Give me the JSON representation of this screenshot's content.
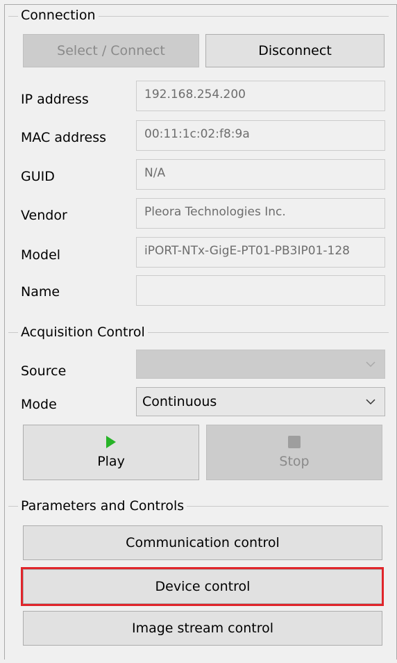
{
  "connection": {
    "title": "Connection",
    "select_connect_label": "Select / Connect",
    "disconnect_label": "Disconnect",
    "fields": [
      {
        "label": "IP address",
        "value": "192.168.254.200"
      },
      {
        "label": "MAC address",
        "value": "00:11:1c:02:f8:9a"
      },
      {
        "label": "GUID",
        "value": "N/A"
      },
      {
        "label": "Vendor",
        "value": "Pleora Technologies Inc."
      },
      {
        "label": "Model",
        "value": "iPORT-NTx-GigE-PT01-PB3IP01-128"
      },
      {
        "label": "Name",
        "value": ""
      }
    ]
  },
  "acquisition": {
    "title": "Acquisition Control",
    "source_label": "Source",
    "source_value": "",
    "mode_label": "Mode",
    "mode_value": "Continuous",
    "play_label": "Play",
    "stop_label": "Stop"
  },
  "parameters": {
    "title": "Parameters and Controls",
    "communication_label": "Communication control",
    "device_label": "Device control",
    "image_stream_label": "Image stream control"
  },
  "colors": {
    "highlight": "#e0252b",
    "play_icon": "#27b327",
    "stop_icon": "#9e9e9e"
  }
}
